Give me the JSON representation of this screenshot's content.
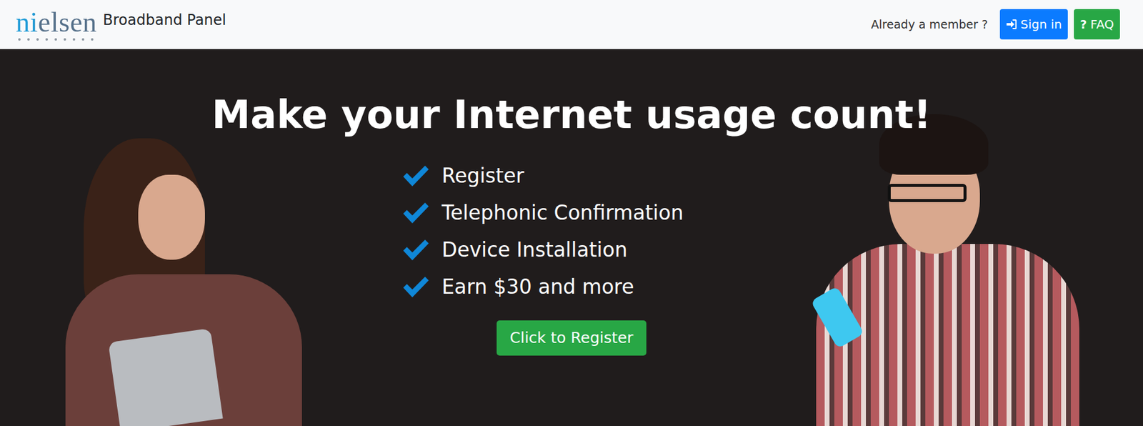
{
  "logo": {
    "brand": "nielsen",
    "product": "Broadband Panel"
  },
  "nav": {
    "prompt": "Already a member ?",
    "signin": {
      "label": "Sign in"
    },
    "faq": {
      "icon": "?",
      "label": "FAQ"
    }
  },
  "hero": {
    "title": "Make your Internet usage count!",
    "steps": [
      {
        "label": "Register",
        "checked": true
      },
      {
        "label": "Telephonic Confirmation",
        "checked": true
      },
      {
        "label": "Device Installation",
        "checked": true
      },
      {
        "label": "Earn $30 and more",
        "checked": true
      }
    ],
    "button": "Click to Register"
  }
}
